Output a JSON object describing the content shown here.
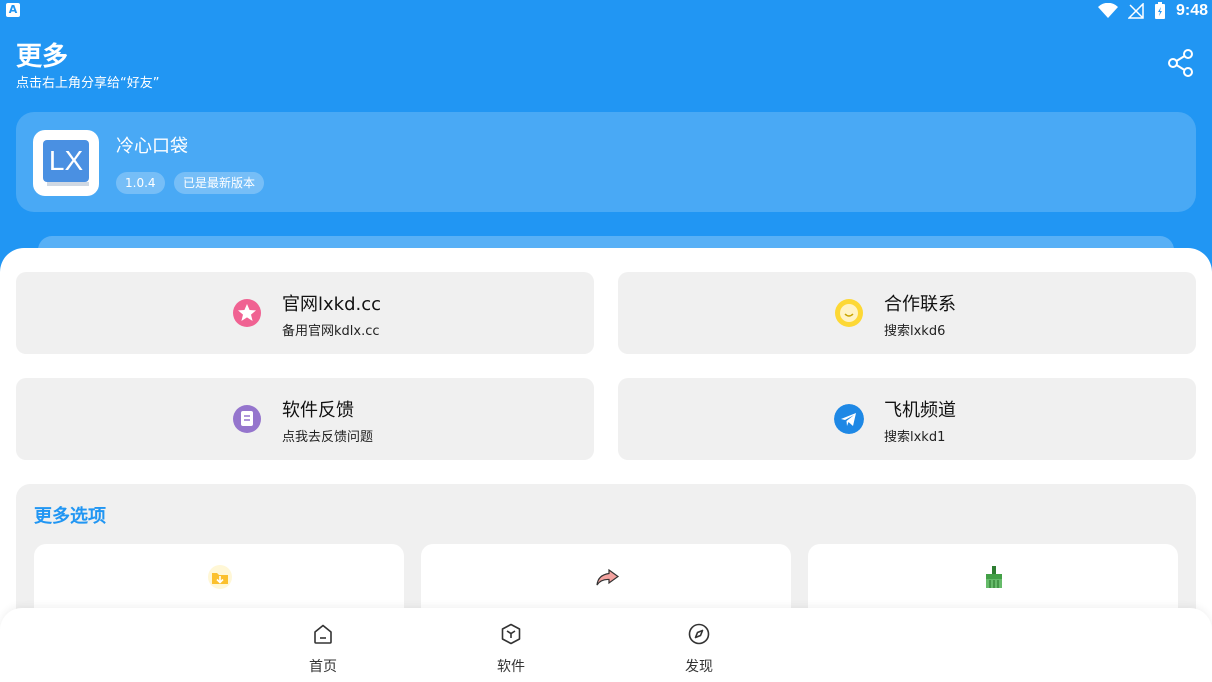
{
  "status": {
    "time": "9:48",
    "badge": "A"
  },
  "header": {
    "title": "更多",
    "subtitle": "点击右上角分享给“好友”"
  },
  "app": {
    "name": "冷心口袋",
    "logo_text": "LX",
    "version": "1.0.4",
    "update_status": "已是最新版本"
  },
  "links": [
    {
      "title": "官网lxkd.cc",
      "subtitle": "备用官网kdlx.cc",
      "icon": "star-icon",
      "color": "#f06292"
    },
    {
      "title": "合作联系",
      "subtitle": "搜索lxkd6",
      "icon": "smile-icon",
      "color": "#fdd835"
    },
    {
      "title": "软件反馈",
      "subtitle": "点我去反馈问题",
      "icon": "feedback-icon",
      "color": "#9575cd"
    },
    {
      "title": "飞机频道",
      "subtitle": "搜索lxkd1",
      "icon": "telegram-icon",
      "color": "#1e88e5"
    }
  ],
  "more": {
    "title": "更多选项",
    "options": [
      {
        "icon": "download-folder-icon"
      },
      {
        "icon": "share-arrow-icon"
      },
      {
        "icon": "clean-brush-icon"
      }
    ]
  },
  "nav": [
    {
      "label": "首页",
      "icon": "home-icon"
    },
    {
      "label": "软件",
      "icon": "cube-icon"
    },
    {
      "label": "发现",
      "icon": "compass-icon"
    }
  ],
  "colors": {
    "primary": "#2196f3",
    "card": "#f0f0f0"
  }
}
